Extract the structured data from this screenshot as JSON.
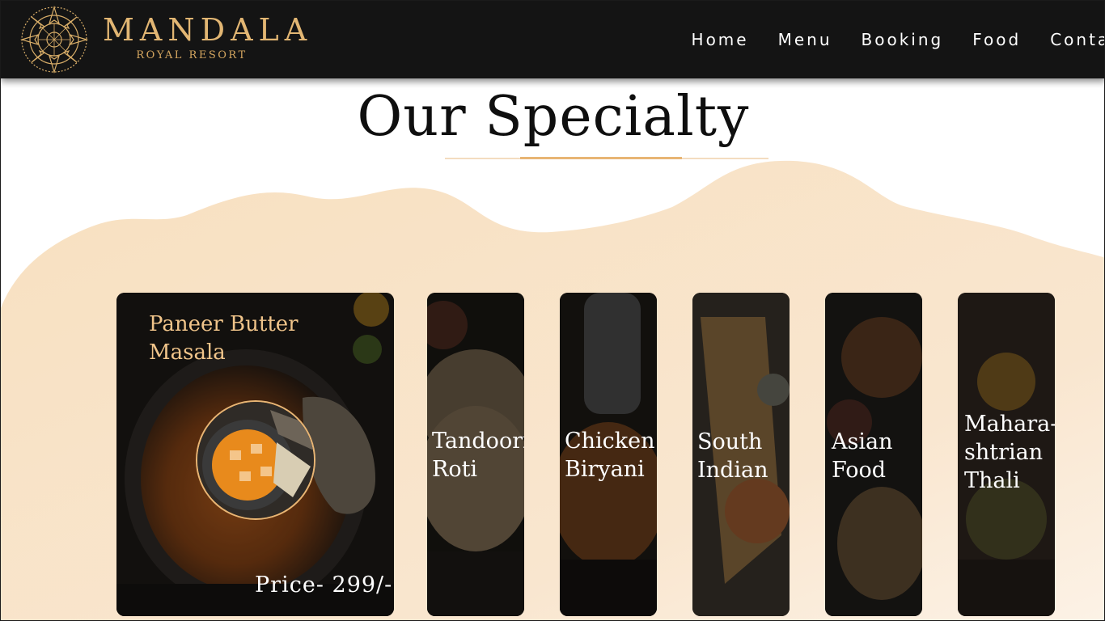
{
  "brand": {
    "name": "MANDALA",
    "subtitle": "ROYAL RESORT"
  },
  "nav": [
    "Home",
    "Menu",
    "Booking",
    "Food",
    "Contact"
  ],
  "section": {
    "title": "Our Specialty"
  },
  "featured": {
    "name_line1": "Paneer Butter",
    "name_line2": "Masala",
    "price": "Price- 299/-"
  },
  "cards": [
    {
      "line1": "Tandoori",
      "line2": "Roti"
    },
    {
      "line1": "Chicken",
      "line2": "Biryani"
    },
    {
      "line1": "South",
      "line2": "Indian"
    },
    {
      "line1": "Asian",
      "line2": "Food"
    },
    {
      "line1": "Mahara-",
      "line2": "shtrian",
      "line3": "Thali"
    }
  ],
  "colors": {
    "header_bg": "#141414",
    "gold": "#e2b673",
    "wave": "#f8e2c6",
    "accent": "#e8b574"
  }
}
